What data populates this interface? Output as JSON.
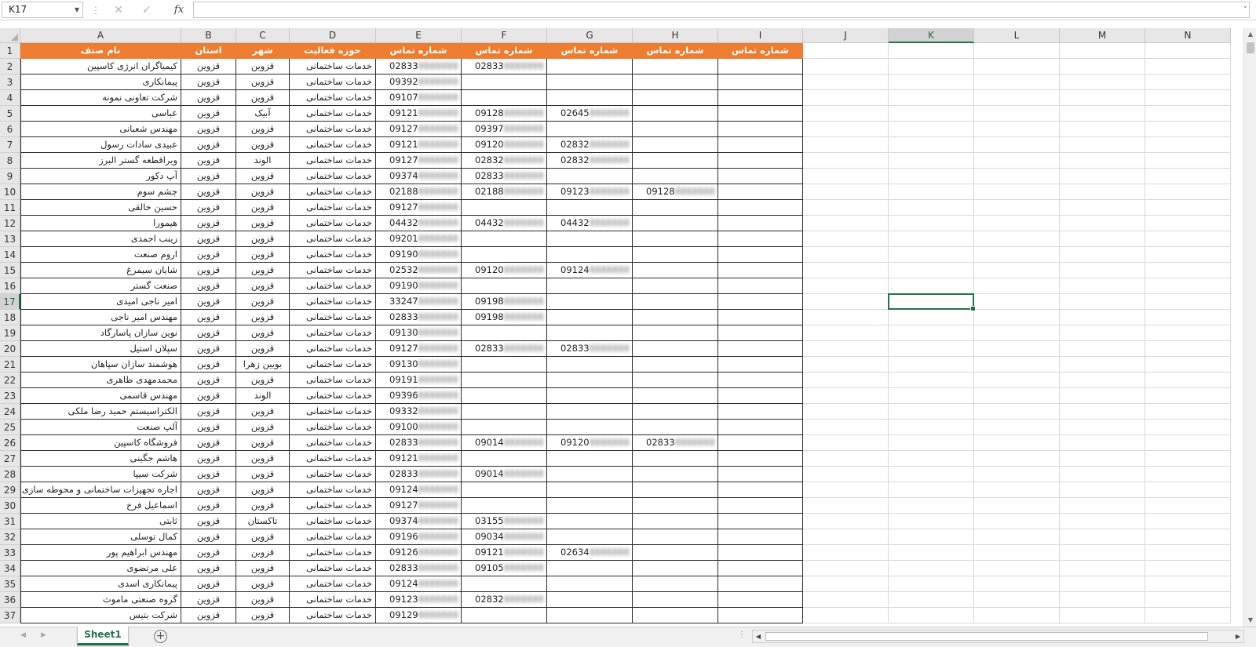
{
  "formula_bar": {
    "name_box": "K17",
    "cancel_icon": "x-icon",
    "enter_icon": "check-icon",
    "fx_label": "fx",
    "formula_value": ""
  },
  "columns": [
    "A",
    "B",
    "C",
    "D",
    "E",
    "F",
    "G",
    "H",
    "I",
    "J",
    "K",
    "L",
    "M",
    "N"
  ],
  "selected_column": "K",
  "selected_row": 17,
  "header_row": [
    "نام صنف",
    "استان",
    "شهر",
    "حوزه فعالیت",
    "شماره تماس",
    "شماره تماس",
    "شماره تماس",
    "شماره تماس",
    "شماره تماس"
  ],
  "rows": [
    {
      "n": 2,
      "a": "کیمیاگران انرژی کاسپین",
      "b": "قزوین",
      "c": "قزوین",
      "d": "خدمات ساختمانی",
      "e": "02833",
      "f": "02833",
      "g": "",
      "h": "",
      "i": ""
    },
    {
      "n": 3,
      "a": "پیمانکاری",
      "b": "قزوین",
      "c": "قزوین",
      "d": "خدمات ساختمانی",
      "e": "09392",
      "f": "",
      "g": "",
      "h": "",
      "i": ""
    },
    {
      "n": 4,
      "a": "شرکت تعاونی نمونه",
      "b": "قزوین",
      "c": "قزوین",
      "d": "خدمات ساختمانی",
      "e": "09107",
      "f": "",
      "g": "",
      "h": "",
      "i": ""
    },
    {
      "n": 5,
      "a": "عباسی",
      "b": "قزوین",
      "c": "آبیک",
      "d": "خدمات ساختمانی",
      "e": "09121",
      "f": "09128",
      "g": "02645",
      "h": "",
      "i": ""
    },
    {
      "n": 6,
      "a": "مهندس شعبانی",
      "b": "قزوین",
      "c": "قزوین",
      "d": "خدمات ساختمانی",
      "e": "09127",
      "f": "09397",
      "g": "",
      "h": "",
      "i": ""
    },
    {
      "n": 7,
      "a": "عبیدی سادات رسول",
      "b": "قزوین",
      "c": "قزوین",
      "d": "خدمات ساختمانی",
      "e": "09121",
      "f": "09120",
      "g": "02832",
      "h": "",
      "i": ""
    },
    {
      "n": 8,
      "a": "ویراقطعه گستر البرز",
      "b": "قزوین",
      "c": "الوند",
      "d": "خدمات ساختمانی",
      "e": "09127",
      "f": "02832",
      "g": "02832",
      "h": "",
      "i": ""
    },
    {
      "n": 9,
      "a": "آپ دکور",
      "b": "قزوین",
      "c": "قزوین",
      "d": "خدمات ساختمانی",
      "e": "09374",
      "f": "02833",
      "g": "",
      "h": "",
      "i": ""
    },
    {
      "n": 10,
      "a": "چشم سوم",
      "b": "قزوین",
      "c": "قزوین",
      "d": "خدمات ساختمانی",
      "e": "02188",
      "f": "02188",
      "g": "09123",
      "h": "09128",
      "i": ""
    },
    {
      "n": 11,
      "a": "حسین خالقی",
      "b": "قزوین",
      "c": "قزوین",
      "d": "خدمات ساختمانی",
      "e": "09127",
      "f": "",
      "g": "",
      "h": "",
      "i": ""
    },
    {
      "n": 12,
      "a": "هیمورا",
      "b": "قزوین",
      "c": "قزوین",
      "d": "خدمات ساختمانی",
      "e": "04432",
      "f": "04432",
      "g": "04432",
      "h": "",
      "i": ""
    },
    {
      "n": 13,
      "a": "زینب احمدی",
      "b": "قزوین",
      "c": "قزوین",
      "d": "خدمات ساختمانی",
      "e": "09201",
      "f": "",
      "g": "",
      "h": "",
      "i": ""
    },
    {
      "n": 14,
      "a": "اروم صنعت",
      "b": "قزوین",
      "c": "قزوین",
      "d": "خدمات ساختمانی",
      "e": "09190",
      "f": "",
      "g": "",
      "h": "",
      "i": ""
    },
    {
      "n": 15,
      "a": "شایان سیمرغ",
      "b": "قزوین",
      "c": "قزوین",
      "d": "خدمات ساختمانی",
      "e": "02532",
      "f": "09120",
      "g": "09124",
      "h": "",
      "i": ""
    },
    {
      "n": 16,
      "a": "صنعت گستر",
      "b": "قزوین",
      "c": "قزوین",
      "d": "خدمات ساختمانی",
      "e": "09190",
      "f": "",
      "g": "",
      "h": "",
      "i": ""
    },
    {
      "n": 17,
      "a": "امیر ناجی امیدی",
      "b": "قزوین",
      "c": "قزوین",
      "d": "خدمات ساختمانی",
      "e": "33247",
      "f": "09198",
      "g": "",
      "h": "",
      "i": ""
    },
    {
      "n": 18,
      "a": "مهندس امیر ناجی",
      "b": "قزوین",
      "c": "قزوین",
      "d": "خدمات ساختمانی",
      "e": "02833",
      "f": "09198",
      "g": "",
      "h": "",
      "i": ""
    },
    {
      "n": 19,
      "a": "نوین سازان پاسارگاد",
      "b": "قزوین",
      "c": "قزوین",
      "d": "خدمات ساختمانی",
      "e": "09130",
      "f": "",
      "g": "",
      "h": "",
      "i": ""
    },
    {
      "n": 20,
      "a": "سپلان استیل",
      "b": "قزوین",
      "c": "قزوین",
      "d": "خدمات ساختمانی",
      "e": "09127",
      "f": "02833",
      "g": "02833",
      "h": "",
      "i": ""
    },
    {
      "n": 21,
      "a": "هوشمند سازان سپاهان",
      "b": "قزوین",
      "c": "بویین زهرا",
      "d": "خدمات ساختمانی",
      "e": "09130",
      "f": "",
      "g": "",
      "h": "",
      "i": ""
    },
    {
      "n": 22,
      "a": "محمدمهدی طاهری",
      "b": "قزوین",
      "c": "قزوین",
      "d": "خدمات ساختمانی",
      "e": "09191",
      "f": "",
      "g": "",
      "h": "",
      "i": ""
    },
    {
      "n": 23,
      "a": "مهندس قاسمی",
      "b": "قزوین",
      "c": "الوند",
      "d": "خدمات ساختمانی",
      "e": "09396",
      "f": "",
      "g": "",
      "h": "",
      "i": ""
    },
    {
      "n": 24,
      "a": "الکتراسیستم حمید رضا ملکی",
      "b": "قزوین",
      "c": "قزوین",
      "d": "خدمات ساختمانی",
      "e": "09332",
      "f": "",
      "g": "",
      "h": "",
      "i": ""
    },
    {
      "n": 25,
      "a": "آلپ صنعت",
      "b": "قزوین",
      "c": "قزوین",
      "d": "خدمات ساختمانی",
      "e": "09100",
      "f": "",
      "g": "",
      "h": "",
      "i": ""
    },
    {
      "n": 26,
      "a": "فروشگاه کاسپین",
      "b": "قزوین",
      "c": "قزوین",
      "d": "خدمات ساختمانی",
      "e": "02833",
      "f": "09014",
      "g": "09120",
      "h": "02833",
      "i": ""
    },
    {
      "n": 27,
      "a": "هاشم جگینی",
      "b": "قزوین",
      "c": "قزوین",
      "d": "خدمات ساختمانی",
      "e": "09121",
      "f": "",
      "g": "",
      "h": "",
      "i": ""
    },
    {
      "n": 28,
      "a": "شرکت سیپا",
      "b": "قزوین",
      "c": "قزوین",
      "d": "خدمات ساختمانی",
      "e": "02833",
      "f": "09014",
      "g": "",
      "h": "",
      "i": ""
    },
    {
      "n": 29,
      "a": "اجاره تجهیزات ساختمانی و محوطه سازی",
      "b": "قزوین",
      "c": "قزوین",
      "d": "خدمات ساختمانی",
      "e": "09124",
      "f": "",
      "g": "",
      "h": "",
      "i": ""
    },
    {
      "n": 30,
      "a": "اسماعیل فرخ",
      "b": "قزوین",
      "c": "قزوین",
      "d": "خدمات ساختمانی",
      "e": "09127",
      "f": "",
      "g": "",
      "h": "",
      "i": ""
    },
    {
      "n": 31,
      "a": "ثابتی",
      "b": "قزوین",
      "c": "تاکستان",
      "d": "خدمات ساختمانی",
      "e": "09374",
      "f": "03155",
      "g": "",
      "h": "",
      "i": ""
    },
    {
      "n": 32,
      "a": "کمال توسلی",
      "b": "قزوین",
      "c": "قزوین",
      "d": "خدمات ساختمانی",
      "e": "09196",
      "f": "09034",
      "g": "",
      "h": "",
      "i": ""
    },
    {
      "n": 33,
      "a": "مهندس ابراهیم پور",
      "b": "قزوین",
      "c": "قزوین",
      "d": "خدمات ساختمانی",
      "e": "09126",
      "f": "09121",
      "g": "02634",
      "h": "",
      "i": ""
    },
    {
      "n": 34,
      "a": "علی مرتضوی",
      "b": "قزوین",
      "c": "قزوین",
      "d": "خدمات ساختمانی",
      "e": "02833",
      "f": "09105",
      "g": "",
      "h": "",
      "i": ""
    },
    {
      "n": 35,
      "a": "پیمانکاری اسدی",
      "b": "قزوین",
      "c": "قزوین",
      "d": "خدمات ساختمانی",
      "e": "09124",
      "f": "",
      "g": "",
      "h": "",
      "i": ""
    },
    {
      "n": 36,
      "a": "گروه صنعتی ماموث",
      "b": "قزوین",
      "c": "قزوین",
      "d": "خدمات ساختمانی",
      "e": "09123",
      "f": "02832",
      "g": "",
      "h": "",
      "i": ""
    },
    {
      "n": 37,
      "a": "شرکت بتیس",
      "b": "قزوین",
      "c": "قزوین",
      "d": "خدمات ساختمانی",
      "e": "09129",
      "f": "",
      "g": "",
      "h": "",
      "i": ""
    }
  ],
  "sheet_tabs": [
    "Sheet1"
  ],
  "colors": {
    "header_fill": "#ed7d31",
    "accent": "#217346"
  },
  "icons": {
    "add_sheet": "plus-circle-icon",
    "name_box_dropdown": "chevron-down-icon"
  }
}
